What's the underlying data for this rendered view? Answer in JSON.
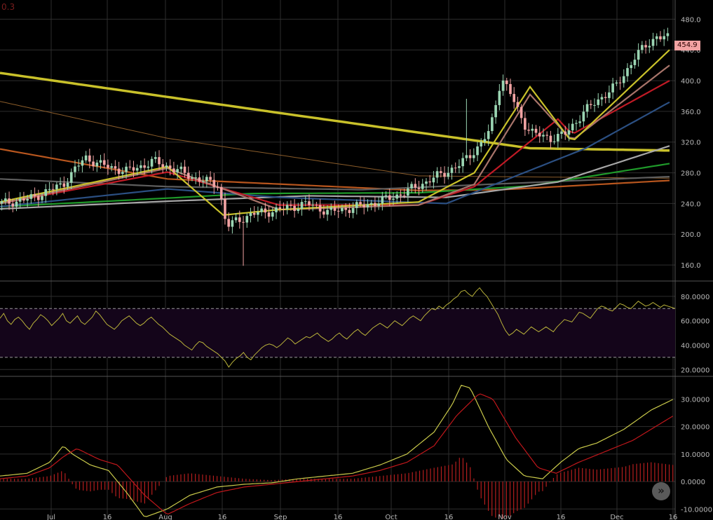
{
  "corner_label": "0.3",
  "scroll_button_icon": "double-chevron-right",
  "colors": {
    "background": "#000000",
    "grid": "#2e2e2e",
    "up_candle": "#9bd6b3",
    "down_candle": "#f2a3a3",
    "rsi_line": "#b9b23a",
    "rsi_band_fill": "#14051a",
    "macd_line": "#c9c94a",
    "signal_line": "#c0171b",
    "histogram": "#b41e1e"
  },
  "chart_data": [
    {
      "type": "candlestick",
      "panel": "price",
      "y_ticks": [
        "480.0",
        "440.0",
        "400.0",
        "360.0",
        "320.0",
        "280.0",
        "240.0",
        "200.0",
        "160.0"
      ],
      "ylim": [
        140,
        505
      ],
      "x_ticks": [
        "Jul",
        "16",
        "Aug",
        "16",
        "Sep",
        "16",
        "Oct",
        "16",
        "Nov",
        "16",
        "Dec",
        "16"
      ],
      "last_price_label": "454.9",
      "candle_count": 183,
      "price_path": [
        [
          0,
          240
        ],
        [
          10,
          246
        ],
        [
          22,
          265
        ],
        [
          30,
          300
        ],
        [
          36,
          290
        ],
        [
          45,
          282
        ],
        [
          55,
          295
        ],
        [
          64,
          282
        ],
        [
          72,
          270
        ],
        [
          78,
          265
        ],
        [
          81,
          210
        ],
        [
          85,
          218
        ],
        [
          90,
          226
        ],
        [
          100,
          232
        ],
        [
          110,
          240
        ],
        [
          118,
          229
        ],
        [
          130,
          237
        ],
        [
          138,
          245
        ],
        [
          145,
          254
        ],
        [
          155,
          272
        ],
        [
          165,
          290
        ],
        [
          172,
          315
        ],
        [
          176,
          335
        ],
        [
          180,
          405
        ],
        [
          183,
          385
        ],
        [
          188,
          345
        ],
        [
          192,
          330
        ],
        [
          198,
          325
        ],
        [
          203,
          330
        ],
        [
          210,
          360
        ],
        [
          216,
          378
        ],
        [
          222,
          395
        ],
        [
          228,
          430
        ],
        [
          232,
          445
        ],
        [
          236,
          458
        ],
        [
          240,
          455
        ]
      ],
      "indicators": [
        {
          "color": "#c9c12a",
          "path": [
            [
              0,
              410
            ],
            [
              100,
              358
            ],
            [
              190,
              312
            ],
            [
              240,
              309
            ]
          ]
        },
        {
          "color": "#8a5c2a",
          "path": [
            [
              0,
              373
            ],
            [
              60,
              325
            ],
            [
              150,
              276
            ],
            [
              240,
              273
            ]
          ]
        },
        {
          "color": "#b8561e",
          "path": [
            [
              0,
              311
            ],
            [
              60,
              272
            ],
            [
              150,
              257
            ],
            [
              180,
              258
            ],
            [
              240,
              270
            ]
          ]
        },
        {
          "color": "#5e5e5e",
          "path": [
            [
              0,
              272
            ],
            [
              60,
              262
            ],
            [
              130,
              258
            ],
            [
              240,
              275
            ]
          ]
        },
        {
          "color": "#1f9a2a",
          "path": [
            [
              0,
              236
            ],
            [
              60,
              247
            ],
            [
              90,
              253
            ],
            [
              150,
              254
            ],
            [
              190,
              263
            ],
            [
              240,
              292
            ]
          ]
        },
        {
          "color": "#a7a7a7",
          "path": [
            [
              0,
              233
            ],
            [
              60,
              243
            ],
            [
              110,
              250
            ],
            [
              160,
              248
            ],
            [
              200,
              268
            ],
            [
              240,
              315
            ]
          ]
        },
        {
          "color": "#2b4f82",
          "path": [
            [
              0,
              236
            ],
            [
              60,
              259
            ],
            [
              100,
              248
            ],
            [
              160,
              240
            ],
            [
              210,
              312
            ],
            [
              240,
              372
            ]
          ]
        },
        {
          "color": "#c01a25",
          "path": [
            [
              0,
              240
            ],
            [
              60,
              281
            ],
            [
              100,
              238
            ],
            [
              150,
              238
            ],
            [
              170,
              262
            ],
            [
              200,
              350
            ],
            [
              205,
              330
            ],
            [
              240,
              400
            ]
          ]
        },
        {
          "color": "#a8746a",
          "path": [
            [
              0,
              240
            ],
            [
              60,
              286
            ],
            [
              100,
              232
            ],
            [
              150,
              238
            ],
            [
              170,
              265
            ],
            [
              190,
              382
            ],
            [
              205,
              322
            ],
            [
              240,
              420
            ]
          ]
        },
        {
          "color": "#c9c12a",
          "path": [
            [
              0,
              242
            ],
            [
              60,
              288
            ],
            [
              80,
              225
            ],
            [
              100,
              232
            ],
            [
              150,
              242
            ],
            [
              170,
              280
            ],
            [
              190,
              392
            ],
            [
              205,
              320
            ],
            [
              240,
              440
            ]
          ]
        }
      ]
    },
    {
      "type": "line",
      "panel": "rsi",
      "y_ticks": [
        "80.0000",
        "60.0000",
        "40.0000",
        "20.0000"
      ],
      "ylim": [
        15,
        92
      ],
      "bands": [
        30,
        70
      ],
      "values": [
        62,
        66,
        60,
        57,
        61,
        63,
        60,
        56,
        53,
        58,
        61,
        65,
        63,
        60,
        56,
        59,
        62,
        66,
        60,
        58,
        61,
        64,
        59,
        57,
        60,
        63,
        68,
        65,
        61,
        57,
        55,
        53,
        56,
        60,
        62,
        64,
        61,
        58,
        56,
        58,
        61,
        63,
        60,
        57,
        55,
        52,
        49,
        47,
        45,
        43,
        40,
        38,
        36,
        40,
        43,
        42,
        39,
        37,
        35,
        33,
        30,
        27,
        22,
        26,
        29,
        31,
        34,
        30,
        28,
        32,
        35,
        38,
        40,
        41,
        40,
        38,
        40,
        43,
        46,
        44,
        41,
        43,
        45,
        47,
        46,
        48,
        50,
        47,
        45,
        43,
        45,
        48,
        50,
        47,
        45,
        48,
        51,
        53,
        50,
        48,
        51,
        54,
        56,
        58,
        56,
        54,
        57,
        60,
        58,
        56,
        59,
        62,
        64,
        62,
        60,
        64,
        67,
        70,
        69,
        72,
        70,
        73,
        75,
        78,
        80,
        84,
        85,
        82,
        80,
        84,
        87,
        83,
        80,
        75,
        70,
        65,
        58,
        52,
        48,
        50,
        53,
        51,
        49,
        52,
        55,
        53,
        51,
        53,
        55,
        53,
        51,
        55,
        58,
        61,
        60,
        59,
        63,
        67,
        66,
        64,
        62,
        66,
        70,
        72,
        71,
        69,
        68,
        71,
        74,
        73,
        71,
        70,
        73,
        76,
        74,
        72,
        73,
        75,
        73,
        71,
        73,
        72,
        71,
        70
      ]
    },
    {
      "type": "line",
      "panel": "macd",
      "y_ticks": [
        "30.0000",
        "20.0000",
        "10.0000",
        "0.0000",
        "-10.0000"
      ],
      "ylim": [
        -14,
        38
      ],
      "series": [
        {
          "values_path": [
            [
              0,
              2
            ],
            [
              30,
              3
            ],
            [
              55,
              7
            ],
            [
              70,
              13
            ],
            [
              80,
              10
            ],
            [
              100,
              6
            ],
            [
              120,
              4
            ],
            [
              140,
              -4
            ],
            [
              160,
              -13
            ],
            [
              185,
              -10
            ],
            [
              210,
              -5
            ],
            [
              240,
              -2
            ],
            [
              270,
              -1
            ],
            [
              300,
              -0.5
            ],
            [
              330,
              1
            ],
            [
              360,
              2
            ],
            [
              390,
              3
            ],
            [
              420,
              6
            ],
            [
              450,
              10
            ],
            [
              480,
              18
            ],
            [
              500,
              28
            ],
            [
              510,
              35
            ],
            [
              520,
              34
            ],
            [
              540,
              20
            ],
            [
              560,
              8
            ],
            [
              580,
              2
            ],
            [
              600,
              1
            ],
            [
              620,
              7
            ],
            [
              640,
              12
            ],
            [
              660,
              14
            ],
            [
              690,
              19
            ],
            [
              720,
              26
            ],
            [
              745,
              30
            ]
          ]
        },
        {
          "values_path": [
            [
              0,
              1
            ],
            [
              30,
              2
            ],
            [
              55,
              5
            ],
            [
              70,
              9
            ],
            [
              85,
              12
            ],
            [
              110,
              8
            ],
            [
              130,
              6
            ],
            [
              160,
              -5
            ],
            [
              185,
              -12
            ],
            [
              210,
              -8
            ],
            [
              240,
              -4
            ],
            [
              270,
              -2
            ],
            [
              300,
              -1
            ],
            [
              330,
              0
            ],
            [
              360,
              1
            ],
            [
              390,
              2
            ],
            [
              420,
              4
            ],
            [
              450,
              7
            ],
            [
              480,
              13
            ],
            [
              505,
              24
            ],
            [
              530,
              32
            ],
            [
              545,
              30
            ],
            [
              570,
              16
            ],
            [
              595,
              5
            ],
            [
              615,
              3
            ],
            [
              640,
              7
            ],
            [
              670,
              11
            ],
            [
              700,
              15
            ],
            [
              745,
              24
            ]
          ]
        }
      ]
    }
  ]
}
